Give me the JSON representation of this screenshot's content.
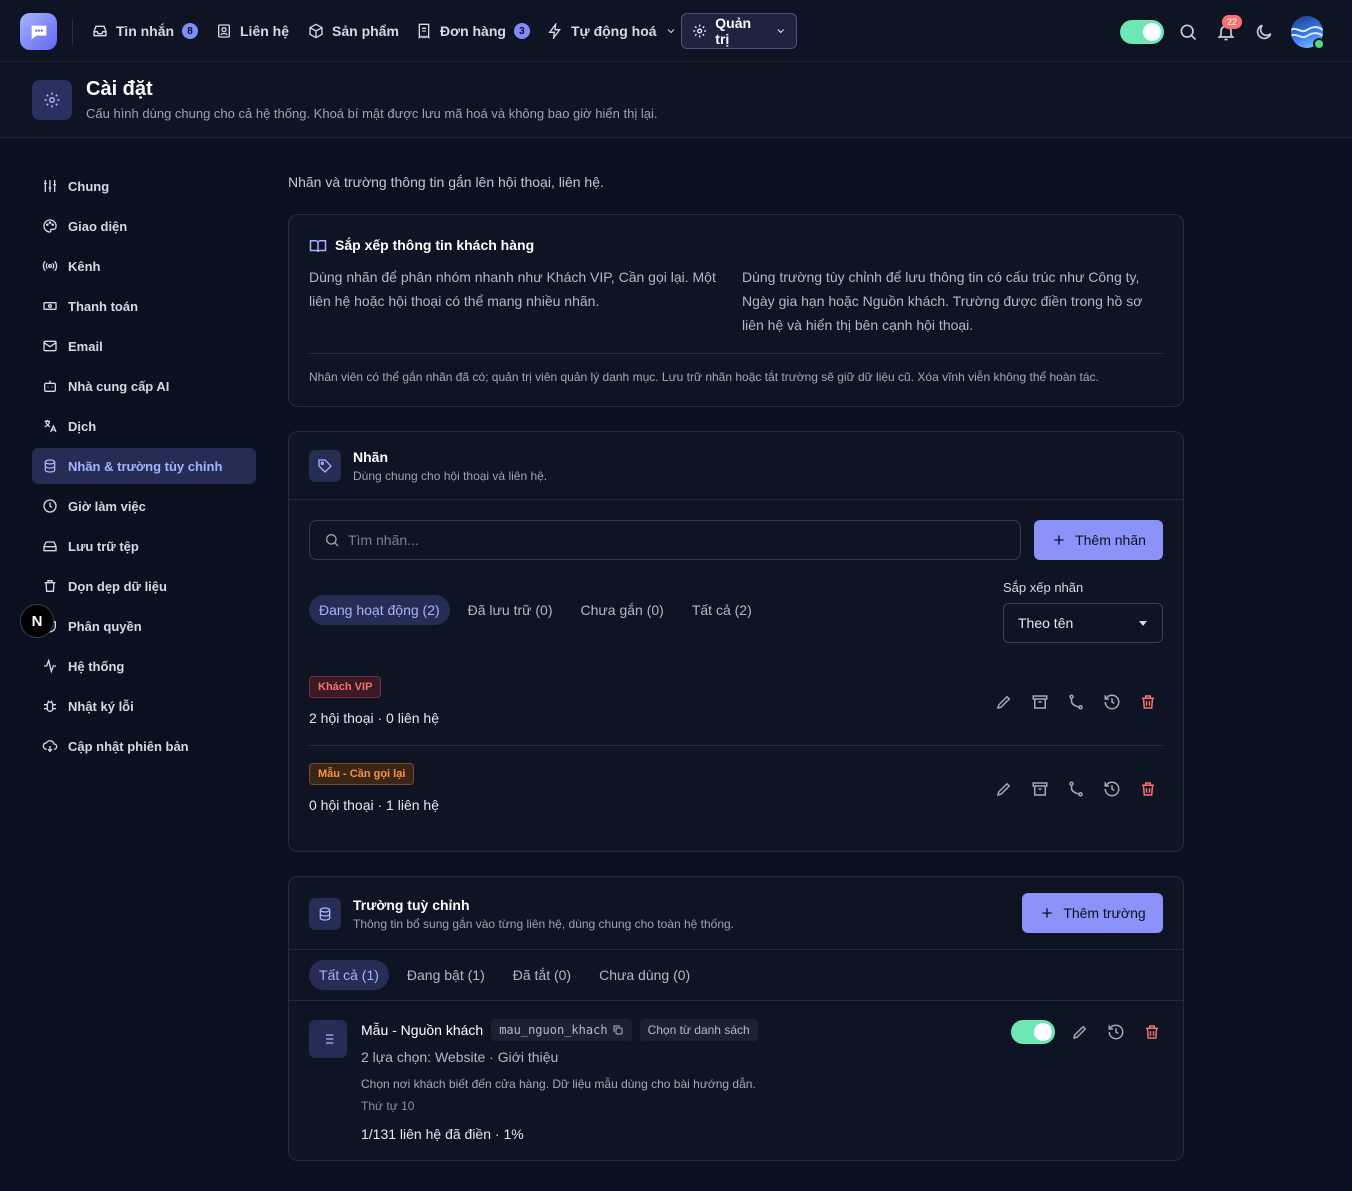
{
  "nav": {
    "items": [
      {
        "label": "Tin nhắn",
        "count": "8"
      },
      {
        "label": "Liên hệ"
      },
      {
        "label": "Sản phẩm"
      },
      {
        "label": "Đơn hàng",
        "count": "3"
      },
      {
        "label": "Tự động hoá"
      },
      {
        "label": "Quản trị"
      }
    ],
    "notifications": "22"
  },
  "header": {
    "title": "Cài đặt",
    "subtitle": "Cấu hình dùng chung cho cả hệ thống. Khoá bí mật được lưu mã hoá và không bao giờ hiển thị lại."
  },
  "sidebar": {
    "items": [
      {
        "label": "Chung"
      },
      {
        "label": "Giao diện"
      },
      {
        "label": "Kênh"
      },
      {
        "label": "Thanh toán"
      },
      {
        "label": "Email"
      },
      {
        "label": "Nhà cung cấp AI"
      },
      {
        "label": "Dịch"
      },
      {
        "label": "Nhãn & trường tùy chỉnh"
      },
      {
        "label": "Giờ làm việc"
      },
      {
        "label": "Lưu trữ tệp"
      },
      {
        "label": "Dọn dẹp dữ liệu"
      },
      {
        "label": "Phân quyền"
      },
      {
        "label": "Hệ thống"
      },
      {
        "label": "Nhật ký lỗi"
      },
      {
        "label": "Cập nhật phiên bản"
      }
    ],
    "floating_badge": "N"
  },
  "main": {
    "intro": "Nhãn và trường thông tin gắn lên hội thoại, liên hệ.",
    "guide": {
      "title": "Sắp xếp thông tin khách hàng",
      "left": "Dùng nhãn để phân nhóm nhanh như Khách VIP, Cần gọi lại. Một liên hệ hoặc hội thoại có thể mang nhiều nhãn.",
      "right": "Dùng trường tùy chỉnh để lưu thông tin có cấu trúc như Công ty, Ngày gia hạn hoặc Nguồn khách. Trường được điền trong hồ sơ liên hệ và hiển thị bên cạnh hội thoại.",
      "note": "Nhân viên có thể gắn nhãn đã có; quản trị viên quản lý danh mục. Lưu trữ nhãn hoặc tắt trường sẽ giữ dữ liệu cũ. Xóa vĩnh viễn không thể hoàn tác."
    },
    "labels": {
      "title": "Nhãn",
      "subtitle": "Dùng chung cho hội thoại và liên hệ.",
      "search_placeholder": "Tìm nhãn...",
      "add_button": "Thêm nhãn",
      "tabs": [
        "Đang hoạt động (2)",
        "Đã lưu trữ (0)",
        "Chưa gắn (0)",
        "Tất cả (2)"
      ],
      "sort_label": "Sắp xếp nhãn",
      "sort_value": "Theo tên",
      "rows": [
        {
          "name": "Khách VIP",
          "stats": "2 hội thoại · 0 liên hệ",
          "color": "#f87171"
        },
        {
          "name": "Mẫu - Cần gọi lại",
          "stats": "0 hội thoại · 1 liên hệ",
          "color": "#fb923c"
        }
      ]
    },
    "fields": {
      "title": "Trường tuỳ chỉnh",
      "subtitle": "Thông tin bổ sung gắn vào từng liên hệ, dùng chung cho toàn hệ thống.",
      "add_button": "Thêm trường",
      "tabs": [
        "Tất cả (1)",
        "Đang bật (1)",
        "Đã tắt (0)",
        "Chưa dùng (0)"
      ],
      "item": {
        "name": "Mẫu - Nguồn khách",
        "key": "mau_nguon_khach",
        "type": "Chọn từ danh sách",
        "options": "2 lựa chọn: Website · Giới thiệu",
        "description": "Chọn nơi khách biết đến cửa hàng. Dữ liệu mẫu dùng cho bài hướng dẫn.",
        "order": "Thứ tự 10",
        "fill": "1/131 liên hệ đã điền · 1%"
      }
    }
  }
}
